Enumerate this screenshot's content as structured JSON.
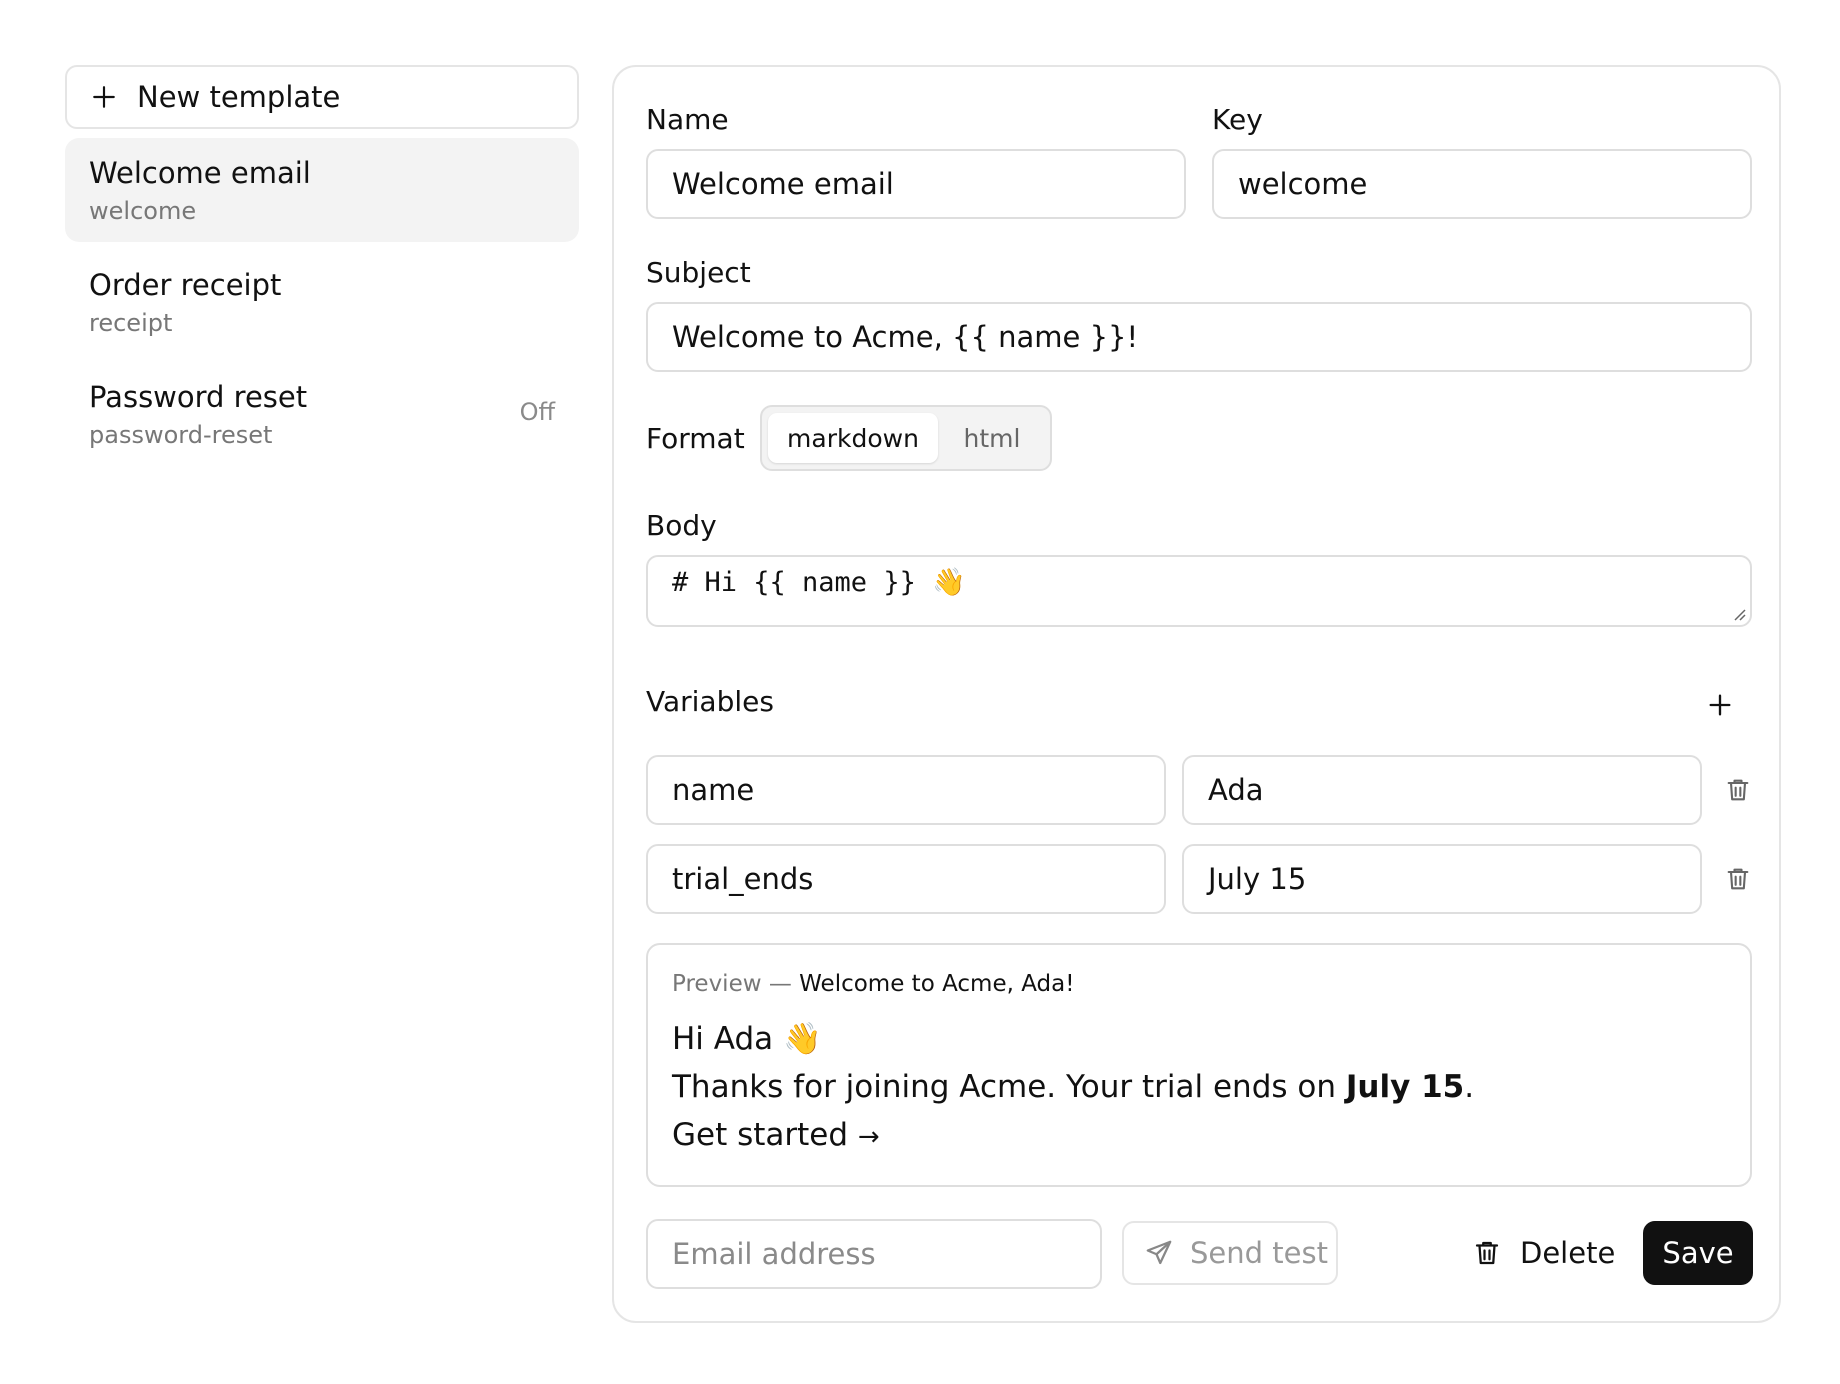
{
  "sidebar": {
    "new_template_label": "New template",
    "items": [
      {
        "name": "Welcome email",
        "key": "welcome",
        "badge": ""
      },
      {
        "name": "Order receipt",
        "key": "receipt",
        "badge": ""
      },
      {
        "name": "Password reset",
        "key": "password-reset",
        "badge": "Off"
      }
    ]
  },
  "editor": {
    "name_label": "Name",
    "name_value": "Welcome email",
    "key_label": "Key",
    "key_value": "welcome",
    "subject_label": "Subject",
    "subject_value": "Welcome to Acme, {{ name }}!",
    "format_label": "Format",
    "format_options": [
      "markdown",
      "html"
    ],
    "format_selected": "markdown",
    "body_label": "Body",
    "body_value": "# Hi {{ name }} 👋",
    "variables_label": "Variables",
    "variables": [
      {
        "key": "name",
        "value": "Ada"
      },
      {
        "key": "trial_ends",
        "value": "July 15"
      }
    ]
  },
  "preview": {
    "prefix": "Preview —",
    "subject": "Welcome to Acme, Ada!",
    "heading": "Hi Ada 👋",
    "text_before": "Thanks for joining Acme. Your trial ends on",
    "text_bold": "July 15",
    "text_after": ".",
    "cta": "Get started",
    "cta_arrow": "→"
  },
  "footer": {
    "email_placeholder": "Email address",
    "send_test_label": "Send test",
    "delete_label": "Delete",
    "save_label": "Save"
  },
  "icons": {
    "add": "plus-icon",
    "delete_variable": "trash-icon",
    "send": "send-icon",
    "delete": "trash-icon"
  }
}
